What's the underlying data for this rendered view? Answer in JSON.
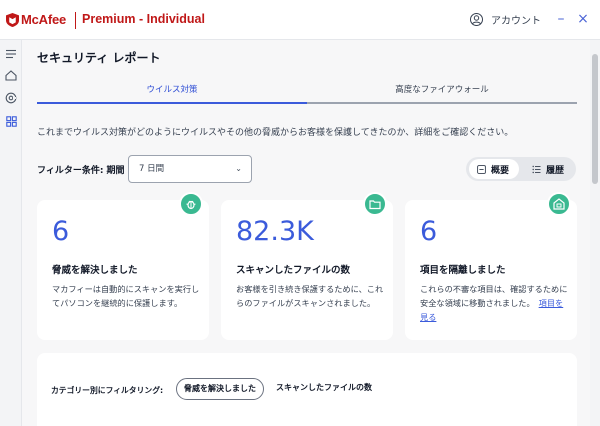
{
  "titlebar": {
    "brand": "McAfee",
    "product": "Premium - Individual",
    "account_label": "アカウント",
    "minimize": "–",
    "close": "×"
  },
  "sidebar": {
    "icons": [
      "menu-icon",
      "home-icon",
      "protection-icon",
      "dashboard-icon"
    ]
  },
  "page": {
    "title": "セキュリティ レポート",
    "tabs": [
      {
        "label": "ウイルス対策",
        "active": true
      },
      {
        "label": "高度なファイアウォール",
        "active": false
      }
    ],
    "description": "これまでウイルス対策がどのようにウイルスやその他の脅威からお客様を保護してきたのか、詳細をご確認ください。",
    "filter": {
      "label": "フィルター条件: 期間",
      "value": "7 日間"
    },
    "view_toggle": {
      "overview": "概要",
      "history": "履歴"
    }
  },
  "cards": [
    {
      "number": "6",
      "title": "脅威を解決しました",
      "desc": "マカフィーは自動的にスキャンを実行してパソコンを継続的に保護します。",
      "icon": "bug-icon"
    },
    {
      "number": "82.3K",
      "title": "スキャンしたファイルの数",
      "desc": "お客様を引き続き保護するために、これらのファイルがスキャンされました。",
      "icon": "folder-icon"
    },
    {
      "number": "6",
      "title": "項目を隔離しました",
      "desc": "これらの不審な項目は、確認するために安全な領域に移動されました。",
      "link": "項目を見る",
      "icon": "quarantine-icon"
    }
  ],
  "category_filter": {
    "label": "カテゴリー別にフィルタリング:",
    "chips": [
      "脅威を解決しました",
      "スキャンしたファイルの数"
    ]
  },
  "colors": {
    "brand_red": "#c01818",
    "accent_blue": "#3b5bdb",
    "badge_green": "#3ab991"
  }
}
